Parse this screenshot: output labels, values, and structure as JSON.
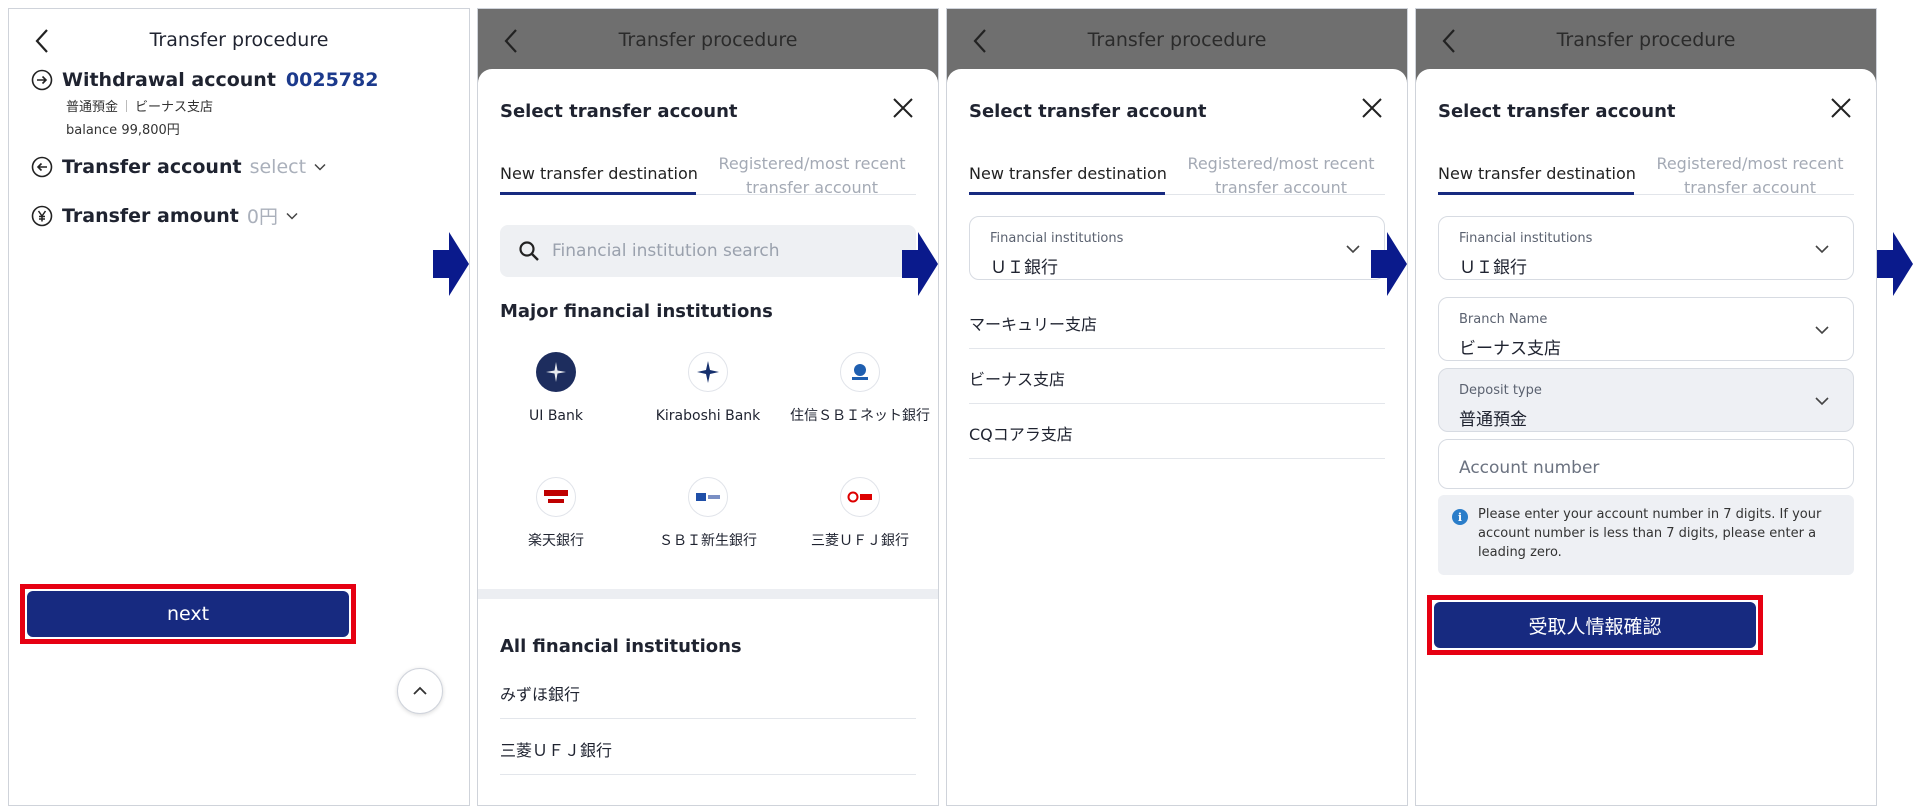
{
  "screen1": {
    "title": "Transfer procedure",
    "withdrawal": {
      "label": "Withdrawal account",
      "number": "0025782",
      "deposit_type": "普通預金",
      "branch": "ビーナス支店",
      "balance": "balance 99,800円"
    },
    "transfer_account": {
      "label": "Transfer account",
      "value": "select"
    },
    "transfer_amount": {
      "label": "Transfer amount",
      "value": "0円"
    },
    "next_label": "next"
  },
  "screen2": {
    "title": "Transfer procedure",
    "sheet_title": "Select transfer account",
    "tab_new": "New transfer destination",
    "tab_registered": "Registered/most recent transfer account",
    "search_placeholder": "Financial institution search",
    "major_title": "Major financial institutions",
    "banks": [
      {
        "name": "UI Bank"
      },
      {
        "name": "Kiraboshi Bank"
      },
      {
        "name": "住信ＳＢＩネット銀行"
      },
      {
        "name": "楽天銀行"
      },
      {
        "name": "ＳＢＩ新生銀行"
      },
      {
        "name": "三菱ＵＦＪ銀行"
      }
    ],
    "all_title": "All financial institutions",
    "all_list": [
      "みずほ銀行",
      "三菱ＵＦＪ銀行"
    ]
  },
  "screen3": {
    "title": "Transfer procedure",
    "sheet_title": "Select transfer account",
    "tab_new": "New transfer destination",
    "tab_registered": "Registered/most recent transfer account",
    "institution_label": "Financial institutions",
    "institution_value": "ＵＩ銀行",
    "branches": [
      "マーキュリー支店",
      "ビーナス支店",
      "CQコアラ支店"
    ]
  },
  "screen4": {
    "title": "Transfer procedure",
    "sheet_title": "Select transfer account",
    "tab_new": "New transfer destination",
    "tab_registered": "Registered/most recent transfer account",
    "institution_label": "Financial institutions",
    "institution_value": "ＵＩ銀行",
    "branch_label": "Branch Name",
    "branch_value": "ビーナス支店",
    "deposit_label": "Deposit type",
    "deposit_value": "普通預金",
    "account_placeholder": "Account number",
    "info_text": "Please enter your account number in 7 digits. If your account number is less than 7 digits, please enter a leading zero.",
    "confirm_label": "受取人情報確認"
  },
  "colors": {
    "primary": "#172a80",
    "highlight": "#e60012",
    "arrow": "#0a1a8c",
    "overlay": "#6f6f6f"
  },
  "icons": [
    "back-chevron-icon",
    "arrow-right-circle-icon",
    "arrow-left-circle-icon",
    "yen-circle-icon",
    "chevron-down-icon",
    "chevron-up-icon",
    "close-icon",
    "search-icon",
    "info-icon",
    "step-arrow-icon"
  ]
}
